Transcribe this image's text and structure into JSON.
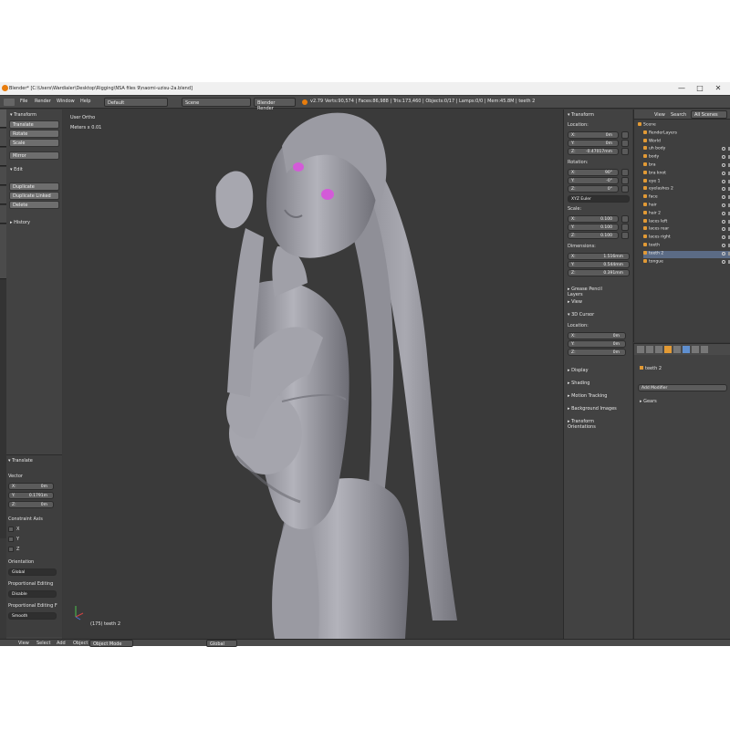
{
  "title": "Blender* [C:\\Users\\Wardialer\\Desktop\\Rigging\\NSA files 9\\naomi-uzisu-2a.blend]",
  "window_controls": [
    "—",
    "□",
    "✕"
  ],
  "menubar": {
    "items": [
      "File",
      "Render",
      "Window",
      "Help"
    ],
    "layout": "Default",
    "scene": "Scene",
    "engine": "Blender Render",
    "version": "v2.79",
    "stats": "Verts:90,574 | Faces:86,988 | Tris:173,460 | Objects:0/17 | Lamps:0/0 | Mem:45.8M | teeth 2"
  },
  "toolshelf": {
    "transform_header": "Transform",
    "transform_buttons": [
      "Translate",
      "Rotate",
      "Scale",
      "Mirror"
    ],
    "edit_header": "Edit",
    "edit_buttons": [
      "Duplicate",
      "Duplicate Linked",
      "Delete"
    ],
    "history_header": "History",
    "side_tabs": [
      "Tools",
      "Create",
      "Relations",
      "Animation",
      "Physics",
      "Grease Pencil",
      "Mesh Align Plus"
    ],
    "operator": {
      "header": "Translate",
      "vector_label": "Vector",
      "x_label": "X:",
      "x_value": "0m",
      "y_label": "Y:",
      "y_value": "0.1791m",
      "z_label": "Z:",
      "z_value": "0m",
      "constraint_label": "Constraint Axis",
      "axes": [
        "X",
        "Y",
        "Z"
      ],
      "orientation_label": "Orientation",
      "orientation_value": "Global",
      "prop_edit_label": "Proportional Editing",
      "prop_edit_value": "Disable",
      "prop_falloff_label": "Proportional Editing F",
      "prop_falloff_value": "Smooth"
    }
  },
  "viewport": {
    "view_name": "User Ortho",
    "units": "Meters x 0.01",
    "object_label": "(175) teeth 2",
    "accent_eye": "#d35bd8"
  },
  "npanel": {
    "transform_header": "Transform",
    "location_label": "Location:",
    "loc": [
      {
        "axis": "X:",
        "value": "0m"
      },
      {
        "axis": "Y:",
        "value": "0m"
      },
      {
        "axis": "Z:",
        "value": "-0.47017mm"
      }
    ],
    "rotation_label": "Rotation:",
    "rot": [
      {
        "axis": "X:",
        "value": "90°"
      },
      {
        "axis": "Y:",
        "value": "-0°"
      },
      {
        "axis": "Z:",
        "value": "0°"
      }
    ],
    "rotation_mode": "XYZ Euler",
    "scale_label": "Scale:",
    "scale": [
      {
        "axis": "X:",
        "value": "0.100"
      },
      {
        "axis": "Y:",
        "value": "0.100"
      },
      {
        "axis": "Z:",
        "value": "0.100"
      }
    ],
    "dimensions_label": "Dimensions:",
    "dims": [
      {
        "axis": "X:",
        "value": "1.516mm"
      },
      {
        "axis": "Y:",
        "value": "0.544mm"
      },
      {
        "axis": "Z:",
        "value": "0.391mm"
      }
    ],
    "sections": [
      "Grease Pencil Layers",
      "View",
      "3D Cursor"
    ],
    "cursor_location_label": "Location:",
    "cursor": [
      {
        "axis": "X:",
        "value": "0m"
      },
      {
        "axis": "Y:",
        "value": "0m"
      },
      {
        "axis": "Z:",
        "value": "0m"
      }
    ],
    "more_sections": [
      "Display",
      "Shading",
      "Motion Tracking",
      "Background Images",
      "Transform Orientations"
    ]
  },
  "outliner": {
    "header_items": [
      "View",
      "Search",
      "All Scenes"
    ],
    "items": [
      {
        "label": "Scene",
        "level": 0
      },
      {
        "label": "RenderLayers",
        "level": 1
      },
      {
        "label": "World",
        "level": 1
      },
      {
        "label": "uh body",
        "level": 1
      },
      {
        "label": "body",
        "level": 1
      },
      {
        "label": "bra",
        "level": 1
      },
      {
        "label": "bra knot",
        "level": 1
      },
      {
        "label": "eye 1",
        "level": 1
      },
      {
        "label": "eyelashes 2",
        "level": 1
      },
      {
        "label": "face",
        "level": 1
      },
      {
        "label": "hair",
        "level": 1
      },
      {
        "label": "hair 2",
        "level": 1
      },
      {
        "label": "laces left",
        "level": 1
      },
      {
        "label": "laces rear",
        "level": 1
      },
      {
        "label": "laces right",
        "level": 1
      },
      {
        "label": "teeth",
        "level": 1
      },
      {
        "label": "teeth 2",
        "level": 1
      },
      {
        "label": "tongue",
        "level": 1
      }
    ]
  },
  "properties": {
    "object_name": "teeth 2",
    "add_modifier": "Add Modifier",
    "gears_label": "Gears"
  },
  "bottombar": {
    "items": [
      "View",
      "Select",
      "Add",
      "Object"
    ],
    "mode": "Object Mode",
    "orientation": "Global"
  }
}
